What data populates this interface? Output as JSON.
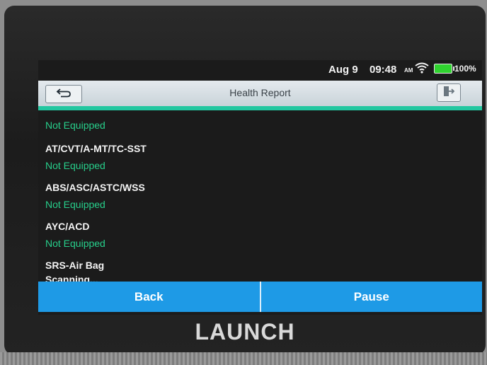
{
  "status_bar": {
    "date": "Aug 9",
    "time": "09:48",
    "ampm": "AM",
    "battery_pct": "100%"
  },
  "header": {
    "title": "Health Report"
  },
  "report": {
    "first_status": "Not Equipped",
    "items": [
      {
        "name": "AT/CVT/A-MT/TC-SST",
        "status": "Not Equipped"
      },
      {
        "name": "ABS/ASC/ASTC/WSS",
        "status": "Not Equipped"
      },
      {
        "name": "AYC/ACD",
        "status": "Not Equipped"
      },
      {
        "name": "SRS-Air Bag",
        "status": "Scanning..."
      }
    ]
  },
  "actions": {
    "back_label": "Back",
    "pause_label": "Pause"
  },
  "device": {
    "brand": "LAUNCH"
  },
  "colors": {
    "accent_teal": "#22c7a0",
    "status_green": "#27cf8b",
    "action_blue": "#1e9ae6"
  },
  "icons": [
    "back-arrow-icon",
    "exit-icon",
    "wifi-icon",
    "battery-icon"
  ]
}
